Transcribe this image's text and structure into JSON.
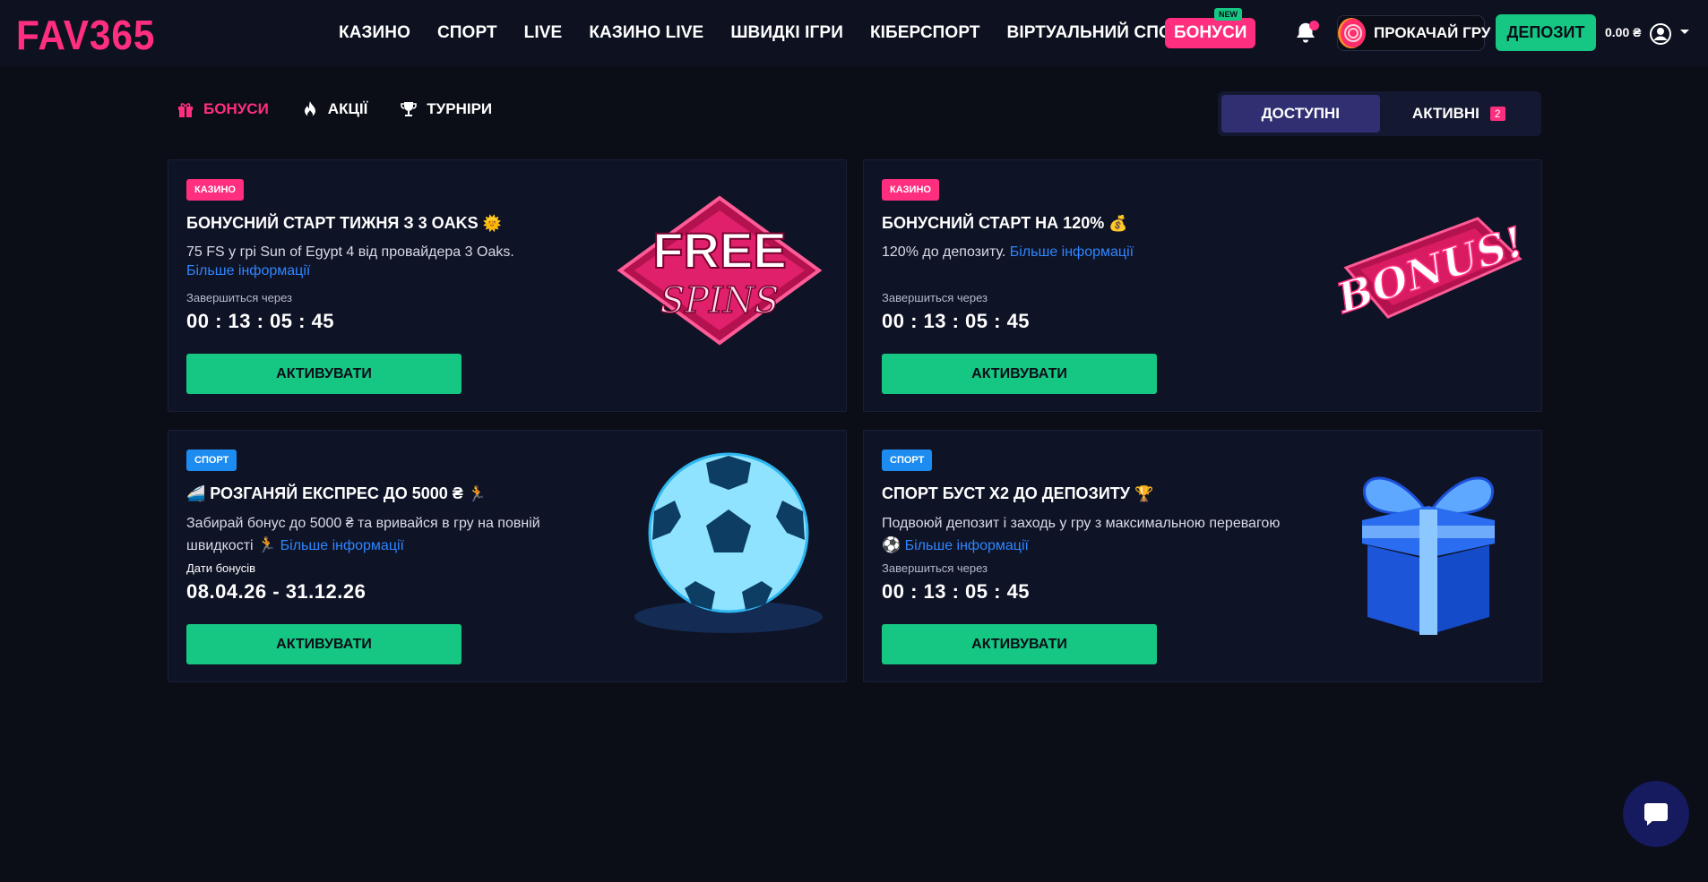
{
  "header": {
    "logo": "FAV365",
    "nav": [
      "КАЗИНО",
      "СПОРТ",
      "LIVE",
      "КАЗИНО LIVE",
      "ШВИДКІ ІГРИ",
      "КІБЕРСПОРТ",
      "ВІРТУАЛЬНИЙ СПОРТ"
    ],
    "more": "...",
    "bonus_label": "БОНУСИ",
    "new_badge": "NEW",
    "level_label": "ПРОКАЧАЙ ГРУ",
    "deposit_label": "ДЕПОЗИТ",
    "balance": "0.00 ₴"
  },
  "subnav": {
    "items": [
      {
        "label": "БОНУСИ",
        "icon": "gift-icon",
        "active": true
      },
      {
        "label": "АКЦІЇ",
        "icon": "fire-icon",
        "active": false
      },
      {
        "label": "ТУРНІРИ",
        "icon": "trophy-icon",
        "active": false
      }
    ]
  },
  "tabs": {
    "available": "ДОСТУПНІ",
    "active": "АКТИВНІ",
    "active_count": "2"
  },
  "cards": [
    {
      "tag": "КАЗИНО",
      "title": "БОНУСНИЙ СТАРТ ТИЖНЯ З 3 OAKS",
      "title_emoji": "🌞",
      "desc": "75 FS у грі Sun of Egypt 4 від провайдера 3 Oaks.",
      "link": "Більше інформації",
      "label": "Завершиться через",
      "value": "00 : 13 : 05 : 45",
      "button": "АКТИВУВАТИ",
      "art_text_1": "FREE",
      "art_text_2": "SPINS"
    },
    {
      "tag": "КАЗИНО",
      "title": "БОНУСНИЙ СТАРТ НА 120%",
      "title_emoji": "💰",
      "desc": "120% до депозиту.",
      "link": "Більше інформації",
      "label": "Завершиться через",
      "value": "00 : 13 : 05 : 45",
      "button": "АКТИВУВАТИ",
      "art_text_1": "BONUS!"
    },
    {
      "tag": "СПОРТ",
      "title_prefix_emoji": "🚄",
      "title": "РОЗГАНЯЙ ЕКСПРЕС ДО 5000 ₴",
      "title_emoji": "🏃",
      "desc": "Забирай бонус до 5000 ₴ та вривайся в гру на повній швидкості",
      "desc_emoji": "🏃",
      "link": "Більше інформації",
      "label": "Дати бонусів",
      "value": "08.04.26 - 31.12.26",
      "button": "АКТИВУВАТИ"
    },
    {
      "tag": "СПОРТ",
      "title": "СПОРТ БУСТ Х2 ДО ДЕПОЗИТУ",
      "title_emoji": "🏆",
      "desc": "Подвоюй депозит і заходь у гру з максимальною перевагою",
      "desc_emoji": "⚽",
      "link": "Більше інформації",
      "label": "Завершиться через",
      "value": "00 : 13 : 05 : 45",
      "button": "АКТИВУВАТИ"
    }
  ],
  "colors": {
    "brand_pink": "#ff2e7e",
    "accent_green": "#16c784",
    "sport_blue": "#1d8cf0",
    "link_blue": "#2e86ff",
    "background": "#0b0d17"
  }
}
